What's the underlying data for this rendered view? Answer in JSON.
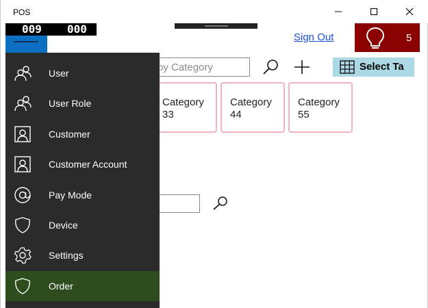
{
  "window": {
    "title": "POS"
  },
  "header": {
    "counter_left": "009",
    "counter_right": "000",
    "sign_out": "Sign Out",
    "notification_count": "5"
  },
  "toolbar": {
    "category_search_placeholder": "by Category",
    "select_table_label": "Select Ta"
  },
  "categories": [
    {
      "line1": "Category",
      "line2": "33"
    },
    {
      "line1": "Category",
      "line2": "44"
    },
    {
      "line1": "Category",
      "line2": "55"
    }
  ],
  "nav": {
    "items": [
      {
        "label": "User",
        "icon": "users-icon"
      },
      {
        "label": "User Role",
        "icon": "users-icon"
      },
      {
        "label": "Customer",
        "icon": "contact-card-icon"
      },
      {
        "label": "Customer Account",
        "icon": "contact-card-icon"
      },
      {
        "label": "Pay Mode",
        "icon": "at-sign-icon"
      },
      {
        "label": "Device",
        "icon": "shield-icon"
      },
      {
        "label": "Settings",
        "icon": "gear-icon"
      },
      {
        "label": "Order",
        "icon": "shield-icon"
      }
    ],
    "active_item": "Order"
  },
  "colors": {
    "nav_background": "#2b2b2b",
    "nav_active": "#2d4d1f",
    "alert_box": "#8b0000",
    "select_table_bg": "#add8e6",
    "tile_border": "#f2b3bf",
    "hamburger_bg": "#0d6fc2",
    "link": "#1a4fd6"
  }
}
